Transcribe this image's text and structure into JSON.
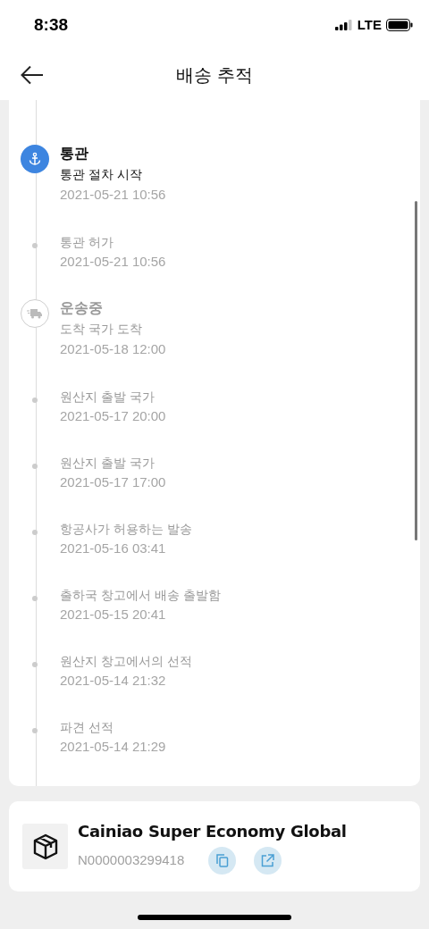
{
  "status_bar": {
    "time": "8:38",
    "network": "LTE"
  },
  "header": {
    "title": "배송 추적"
  },
  "events": [
    {
      "kind": "major",
      "active": true,
      "title": "통관",
      "text": "통관 절차 시작",
      "date": "2021-05-21 10:56"
    },
    {
      "kind": "minor",
      "text": "통관 허가",
      "date": "2021-05-21 10:56"
    },
    {
      "kind": "major",
      "active": false,
      "title": "운송중",
      "text": "도착 국가 도착",
      "date": "2021-05-18 12:00"
    },
    {
      "kind": "minor",
      "text": "원산지 출발 국가",
      "date": "2021-05-17 20:00"
    },
    {
      "kind": "minor",
      "text": "원산지 출발 국가",
      "date": "2021-05-17 17:00"
    },
    {
      "kind": "minor",
      "text": "항공사가 허용하는 발송",
      "date": "2021-05-16 03:41"
    },
    {
      "kind": "minor",
      "text": "출하국 창고에서 배송 출발함",
      "date": "2021-05-15 20:41"
    },
    {
      "kind": "minor",
      "text": "원산지 창고에서의 선적",
      "date": "2021-05-14 21:32"
    },
    {
      "kind": "minor",
      "text": "파견 선적",
      "date": "2021-05-14 21:29"
    }
  ],
  "carrier": {
    "name": "Cainiao Super Economy Global",
    "tracking_number": "N0000003299418"
  }
}
